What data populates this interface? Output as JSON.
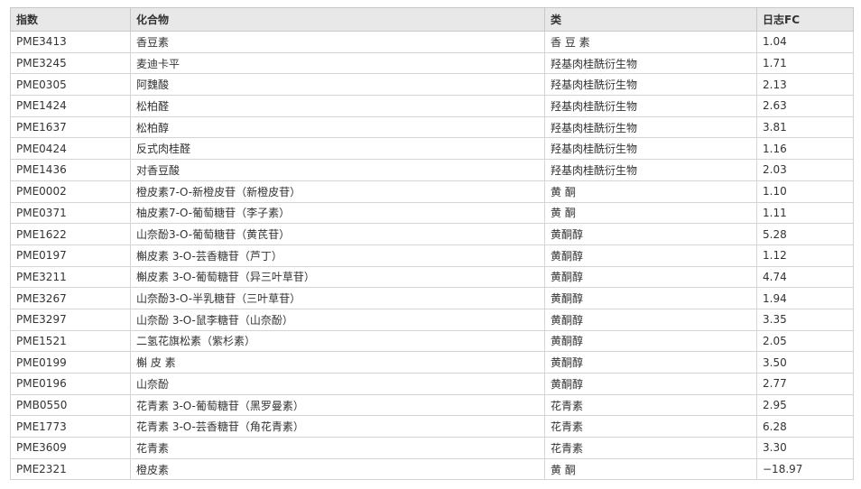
{
  "table": {
    "headers": [
      "指数",
      "化合物",
      "类",
      "日志FC"
    ],
    "rows": [
      [
        "PME3413",
        "香豆素",
        "香 豆 素",
        "1.04"
      ],
      [
        "PME3245",
        "麦迪卡平",
        "羟基肉桂酰衍生物",
        "1.71"
      ],
      [
        "PME0305",
        "阿魏酸",
        "羟基肉桂酰衍生物",
        "2.13"
      ],
      [
        "PME1424",
        "松柏醛",
        "羟基肉桂酰衍生物",
        "2.63"
      ],
      [
        "PME1637",
        "松柏醇",
        "羟基肉桂酰衍生物",
        "3.81"
      ],
      [
        "PME0424",
        "反式肉桂醛",
        "羟基肉桂酰衍生物",
        "1.16"
      ],
      [
        "PME1436",
        "对香豆酸",
        "羟基肉桂酰衍生物",
        "2.03"
      ],
      [
        "PME0002",
        "橙皮素7-O-新橙皮苷（新橙皮苷）",
        "黄 酮",
        "1.10"
      ],
      [
        "PME0371",
        "柚皮素7-O-葡萄糖苷（李子素）",
        "黄 酮",
        "1.11"
      ],
      [
        "PME1622",
        "山奈酚3-O-葡萄糖苷（黄芪苷）",
        "黄酮醇",
        "5.28"
      ],
      [
        "PME0197",
        "槲皮素 3-O-芸香糖苷（芦丁）",
        "黄酮醇",
        "1.12"
      ],
      [
        "PME3211",
        "槲皮素 3-O-葡萄糖苷（异三叶草苷）",
        "黄酮醇",
        "4.74"
      ],
      [
        "PME3267",
        "山奈酚3-O-半乳糖苷（三叶草苷）",
        "黄酮醇",
        "1.94"
      ],
      [
        "PME3297",
        "山奈酚 3-O-鼠李糖苷（山奈酚）",
        "黄酮醇",
        "3.35"
      ],
      [
        "PME1521",
        "二氢花旗松素（紫杉素）",
        "黄酮醇",
        "2.05"
      ],
      [
        "PME0199",
        "槲 皮 素",
        "黄酮醇",
        "3.50"
      ],
      [
        "PME0196",
        "山奈酚",
        "黄酮醇",
        "2.77"
      ],
      [
        "PMB0550",
        "花青素 3-O-葡萄糖苷（黑罗曼素）",
        "花青素",
        "2.95"
      ],
      [
        "PME1773",
        "花青素 3-O-芸香糖苷（角花青素）",
        "花青素",
        "6.28"
      ],
      [
        "PME3609",
        "花青素",
        "花青素",
        "3.30"
      ],
      [
        "PME2321",
        "橙皮素",
        "黄 酮",
        "−18.97"
      ]
    ]
  }
}
